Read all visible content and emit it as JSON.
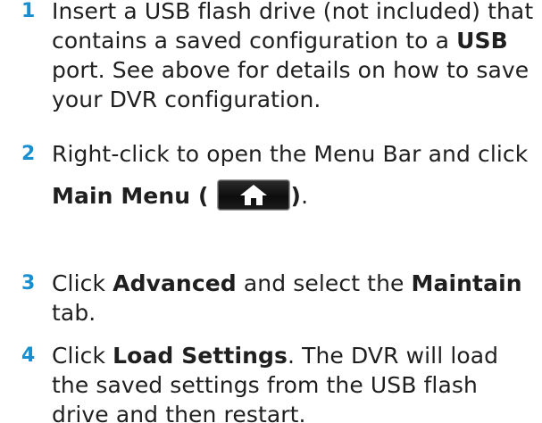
{
  "colors": {
    "step_number": "#1a8fcf",
    "text": "#1f1f1f",
    "button_bg": "#111111"
  },
  "steps": [
    {
      "number": "1",
      "text_a": "Insert a USB flash drive (not included) that contains a saved configuration to a ",
      "bold_a": "USB",
      "text_b": " port. See above for details on how to save your DVR configuration."
    },
    {
      "number": "2",
      "text_a": "Right-click to open the Menu Bar and click",
      "bold_a": "Main Menu (",
      "icon": "home-icon",
      "bold_b": ")",
      "text_b": "."
    },
    {
      "number": "3",
      "text_a": "Click ",
      "bold_a": "Advanced",
      "text_b": " and select the ",
      "bold_b": "Maintain",
      "text_c": " tab."
    },
    {
      "number": "4",
      "text_a": "Click ",
      "bold_a": "Load Settings",
      "text_b": ". The DVR will load the saved settings from the USB flash drive and then restart."
    }
  ]
}
